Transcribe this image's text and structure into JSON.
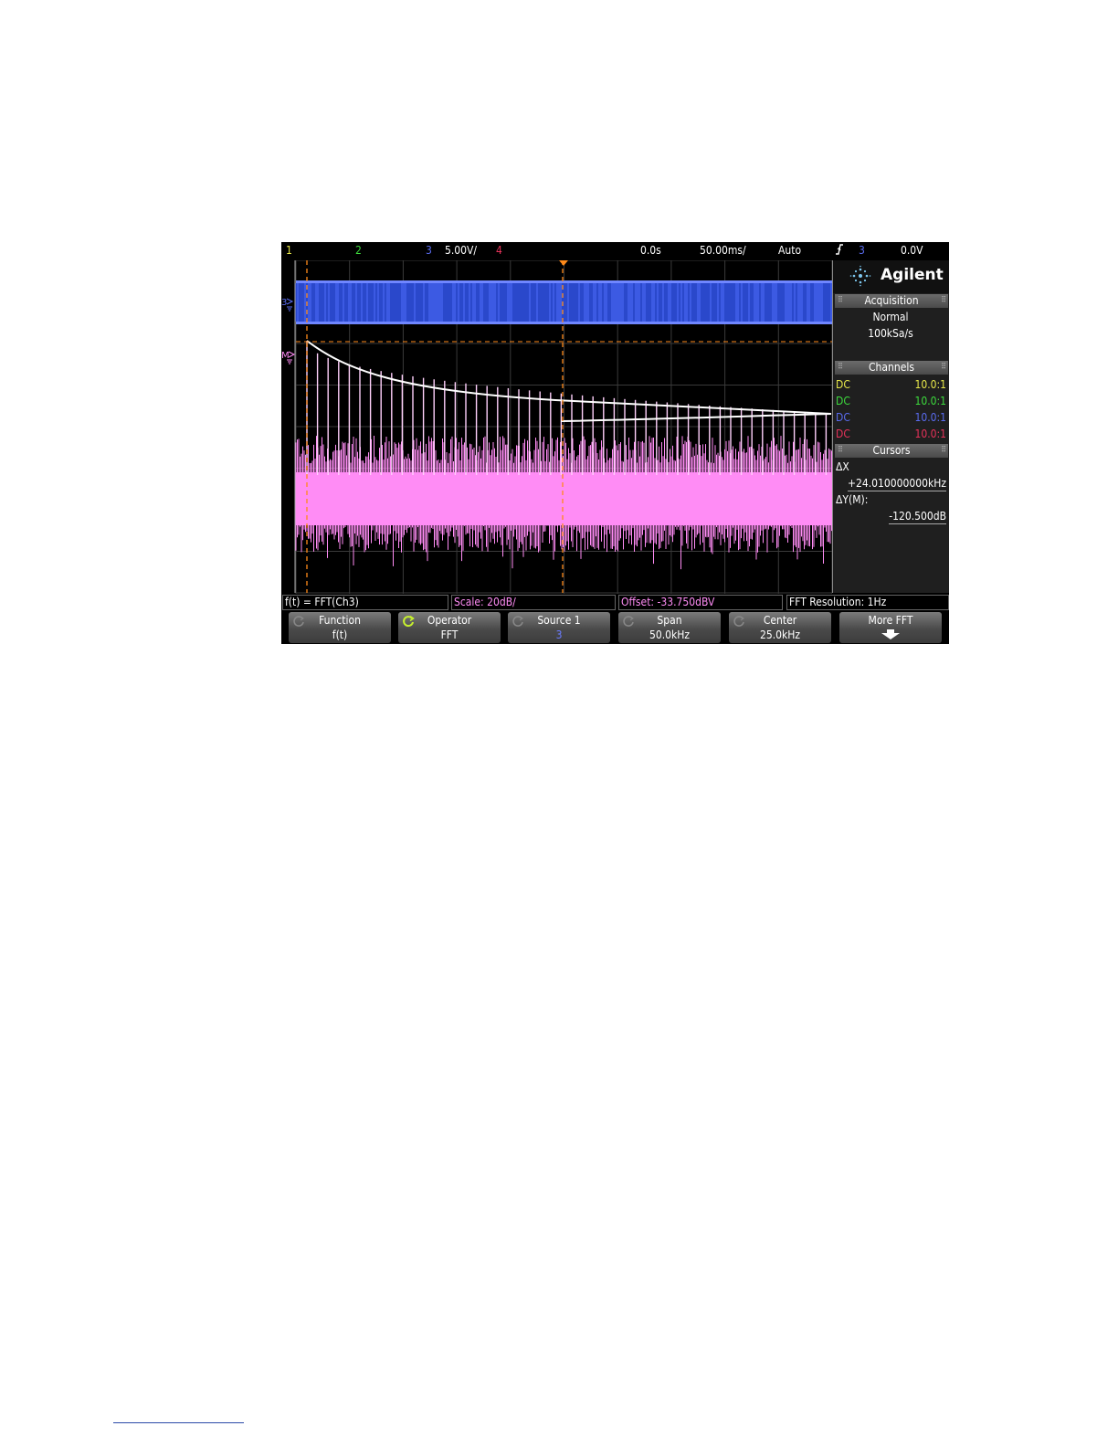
{
  "topbar": {
    "ch1": "1",
    "ch2": "2",
    "ch3": "3",
    "ch3_scale": "5.00V/",
    "ch4": "4",
    "time_delay": "0.0s",
    "time_scale": "50.00ms/",
    "trigger_mode": "Auto",
    "trigger_icon": "rising-edge-icon",
    "trigger_source": "3",
    "trigger_level": "0.0V"
  },
  "markers": {
    "ch3_marker": "3",
    "math_marker": "M"
  },
  "brand": {
    "logo_text": "Agilent",
    "logo_icon": "agilent-spark-icon"
  },
  "acquisition": {
    "title": "Acquisition",
    "mode": "Normal",
    "rate": "100kSa/s"
  },
  "channels": {
    "title": "Channels",
    "rows": [
      {
        "coupling": "DC",
        "probe": "10.0:1",
        "color": "#e8e84a"
      },
      {
        "coupling": "DC",
        "probe": "10.0:1",
        "color": "#3ddc3d"
      },
      {
        "coupling": "DC",
        "probe": "10.0:1",
        "color": "#5a6cf0"
      },
      {
        "coupling": "DC",
        "probe": "10.0:1",
        "color": "#e8325a"
      }
    ]
  },
  "cursors": {
    "title": "Cursors",
    "dx_label": "ΔX",
    "dx_value": "+24.010000000kHz",
    "dy_label": "ΔY(M):",
    "dy_value": "-120.500dB"
  },
  "status": {
    "function": "f(t) = FFT(Ch3)",
    "scale": "Scale: 20dB/",
    "offset": "Offset: -33.750dBV",
    "resolution": "FFT Resolution: 1Hz"
  },
  "softkeys": [
    {
      "label": "Function",
      "value": "f(t)"
    },
    {
      "label": "Operator",
      "value": "FFT"
    },
    {
      "label": "Source 1",
      "value": "3"
    },
    {
      "label": "Span",
      "value": "50.0kHz"
    },
    {
      "label": "Center",
      "value": "25.0kHz"
    },
    {
      "label": "More FFT",
      "value": ""
    }
  ],
  "colors": {
    "ch1": "#e8e84a",
    "ch2": "#3ddc3d",
    "ch3": "#5a6cf0",
    "ch4": "#e8325a",
    "math": "#ff8cf5",
    "trigger_marker": "#ff8a1a",
    "cursor": "#ff8a1a"
  }
}
